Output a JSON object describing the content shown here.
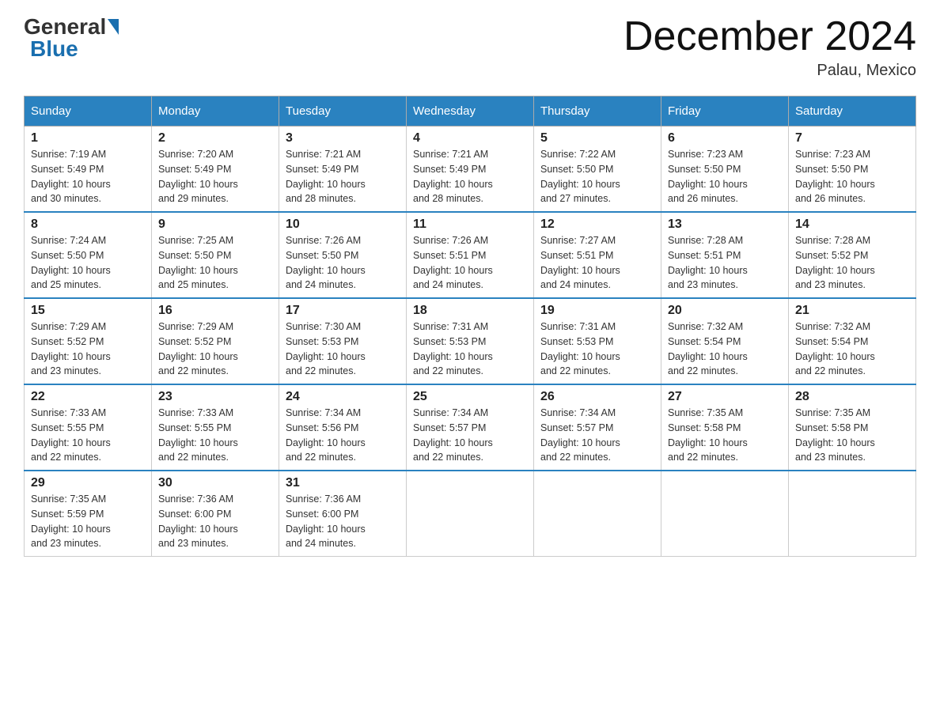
{
  "logo": {
    "general": "General",
    "blue": "Blue"
  },
  "title": "December 2024",
  "location": "Palau, Mexico",
  "days_of_week": [
    "Sunday",
    "Monday",
    "Tuesday",
    "Wednesday",
    "Thursday",
    "Friday",
    "Saturday"
  ],
  "weeks": [
    [
      {
        "day": "1",
        "sunrise": "7:19 AM",
        "sunset": "5:49 PM",
        "daylight": "10 hours and 30 minutes."
      },
      {
        "day": "2",
        "sunrise": "7:20 AM",
        "sunset": "5:49 PM",
        "daylight": "10 hours and 29 minutes."
      },
      {
        "day": "3",
        "sunrise": "7:21 AM",
        "sunset": "5:49 PM",
        "daylight": "10 hours and 28 minutes."
      },
      {
        "day": "4",
        "sunrise": "7:21 AM",
        "sunset": "5:49 PM",
        "daylight": "10 hours and 28 minutes."
      },
      {
        "day": "5",
        "sunrise": "7:22 AM",
        "sunset": "5:50 PM",
        "daylight": "10 hours and 27 minutes."
      },
      {
        "day": "6",
        "sunrise": "7:23 AM",
        "sunset": "5:50 PM",
        "daylight": "10 hours and 26 minutes."
      },
      {
        "day": "7",
        "sunrise": "7:23 AM",
        "sunset": "5:50 PM",
        "daylight": "10 hours and 26 minutes."
      }
    ],
    [
      {
        "day": "8",
        "sunrise": "7:24 AM",
        "sunset": "5:50 PM",
        "daylight": "10 hours and 25 minutes."
      },
      {
        "day": "9",
        "sunrise": "7:25 AM",
        "sunset": "5:50 PM",
        "daylight": "10 hours and 25 minutes."
      },
      {
        "day": "10",
        "sunrise": "7:26 AM",
        "sunset": "5:50 PM",
        "daylight": "10 hours and 24 minutes."
      },
      {
        "day": "11",
        "sunrise": "7:26 AM",
        "sunset": "5:51 PM",
        "daylight": "10 hours and 24 minutes."
      },
      {
        "day": "12",
        "sunrise": "7:27 AM",
        "sunset": "5:51 PM",
        "daylight": "10 hours and 24 minutes."
      },
      {
        "day": "13",
        "sunrise": "7:28 AM",
        "sunset": "5:51 PM",
        "daylight": "10 hours and 23 minutes."
      },
      {
        "day": "14",
        "sunrise": "7:28 AM",
        "sunset": "5:52 PM",
        "daylight": "10 hours and 23 minutes."
      }
    ],
    [
      {
        "day": "15",
        "sunrise": "7:29 AM",
        "sunset": "5:52 PM",
        "daylight": "10 hours and 23 minutes."
      },
      {
        "day": "16",
        "sunrise": "7:29 AM",
        "sunset": "5:52 PM",
        "daylight": "10 hours and 22 minutes."
      },
      {
        "day": "17",
        "sunrise": "7:30 AM",
        "sunset": "5:53 PM",
        "daylight": "10 hours and 22 minutes."
      },
      {
        "day": "18",
        "sunrise": "7:31 AM",
        "sunset": "5:53 PM",
        "daylight": "10 hours and 22 minutes."
      },
      {
        "day": "19",
        "sunrise": "7:31 AM",
        "sunset": "5:53 PM",
        "daylight": "10 hours and 22 minutes."
      },
      {
        "day": "20",
        "sunrise": "7:32 AM",
        "sunset": "5:54 PM",
        "daylight": "10 hours and 22 minutes."
      },
      {
        "day": "21",
        "sunrise": "7:32 AM",
        "sunset": "5:54 PM",
        "daylight": "10 hours and 22 minutes."
      }
    ],
    [
      {
        "day": "22",
        "sunrise": "7:33 AM",
        "sunset": "5:55 PM",
        "daylight": "10 hours and 22 minutes."
      },
      {
        "day": "23",
        "sunrise": "7:33 AM",
        "sunset": "5:55 PM",
        "daylight": "10 hours and 22 minutes."
      },
      {
        "day": "24",
        "sunrise": "7:34 AM",
        "sunset": "5:56 PM",
        "daylight": "10 hours and 22 minutes."
      },
      {
        "day": "25",
        "sunrise": "7:34 AM",
        "sunset": "5:57 PM",
        "daylight": "10 hours and 22 minutes."
      },
      {
        "day": "26",
        "sunrise": "7:34 AM",
        "sunset": "5:57 PM",
        "daylight": "10 hours and 22 minutes."
      },
      {
        "day": "27",
        "sunrise": "7:35 AM",
        "sunset": "5:58 PM",
        "daylight": "10 hours and 22 minutes."
      },
      {
        "day": "28",
        "sunrise": "7:35 AM",
        "sunset": "5:58 PM",
        "daylight": "10 hours and 23 minutes."
      }
    ],
    [
      {
        "day": "29",
        "sunrise": "7:35 AM",
        "sunset": "5:59 PM",
        "daylight": "10 hours and 23 minutes."
      },
      {
        "day": "30",
        "sunrise": "7:36 AM",
        "sunset": "6:00 PM",
        "daylight": "10 hours and 23 minutes."
      },
      {
        "day": "31",
        "sunrise": "7:36 AM",
        "sunset": "6:00 PM",
        "daylight": "10 hours and 24 minutes."
      },
      null,
      null,
      null,
      null
    ]
  ],
  "labels": {
    "sunrise": "Sunrise:",
    "sunset": "Sunset:",
    "daylight": "Daylight:"
  }
}
